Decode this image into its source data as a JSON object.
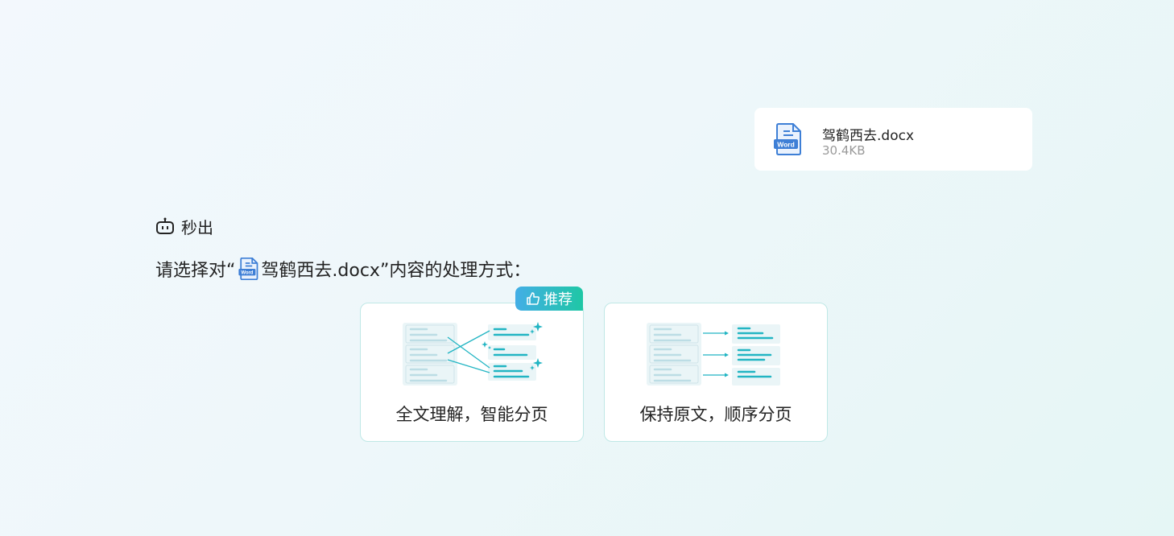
{
  "uploaded_file": {
    "name": "驾鹤西去.docx",
    "size": "30.4KB",
    "icon": "word-file-icon",
    "icon_label": "Word"
  },
  "assistant": {
    "name": "秒出",
    "icon": "robot-icon"
  },
  "prompt": {
    "prefix": "请选择对“",
    "file_name": "驾鹤西去.docx",
    "suffix": "”内容的处理方式："
  },
  "options": [
    {
      "label": "全文理解，智能分页",
      "badge": "推荐",
      "badge_icon": "thumbs-up-icon",
      "illustration": "smart-pagination-illustration"
    },
    {
      "label": "保持原文，顺序分页",
      "illustration": "sequential-pagination-illustration"
    }
  ],
  "colors": {
    "accent_teal": "#22b5c3",
    "badge_gradient_start": "#43aee6",
    "badge_gradient_end": "#1fc7a5",
    "word_blue": "#3e7fd6",
    "card_border": "#bfe8e6"
  }
}
